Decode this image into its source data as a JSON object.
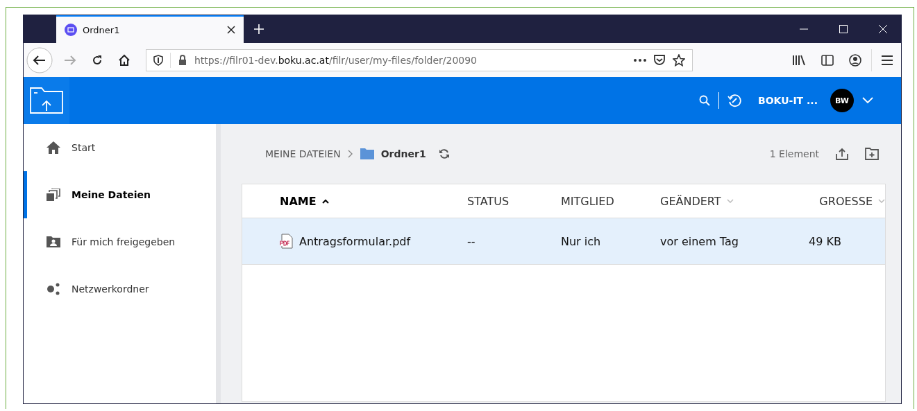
{
  "browser": {
    "tabs": [
      {
        "title": "Ordner1",
        "selected": true
      }
    ],
    "url": {
      "prefix": "https://filr01-dev.",
      "domain": "boku.ac.at",
      "path": "/filr/user/my-files/folder/20090"
    }
  },
  "header": {
    "user_name": "BOKU-IT ...",
    "avatar": "BW"
  },
  "sidebar": {
    "items": [
      {
        "label": "Start",
        "kind": "home",
        "selected": false
      },
      {
        "label": "Meine Dateien",
        "kind": "files",
        "selected": true
      },
      {
        "label": "Für mich freigegeben",
        "kind": "shared",
        "selected": false
      },
      {
        "label": "Netzwerkordner",
        "kind": "network",
        "selected": false
      }
    ]
  },
  "breadcrumb": {
    "root": "MEINE DATEIEN",
    "current": "Ordner1"
  },
  "item_count": "1 Element",
  "table": {
    "columns": [
      {
        "label": "NAME",
        "kind": "sorted"
      },
      {
        "label": "STATUS",
        "kind": "plain"
      },
      {
        "label": "MITGLIED",
        "kind": "plain"
      },
      {
        "label": "GEÄNDERT",
        "kind": "sortable"
      },
      {
        "label": "GROESSE",
        "kind": "sortable"
      }
    ],
    "rows": [
      {
        "selected": true,
        "cells": [
          "Antragsformular.pdf",
          "--",
          "Nur ich",
          "vor einem Tag",
          "49 KB"
        ]
      }
    ]
  }
}
